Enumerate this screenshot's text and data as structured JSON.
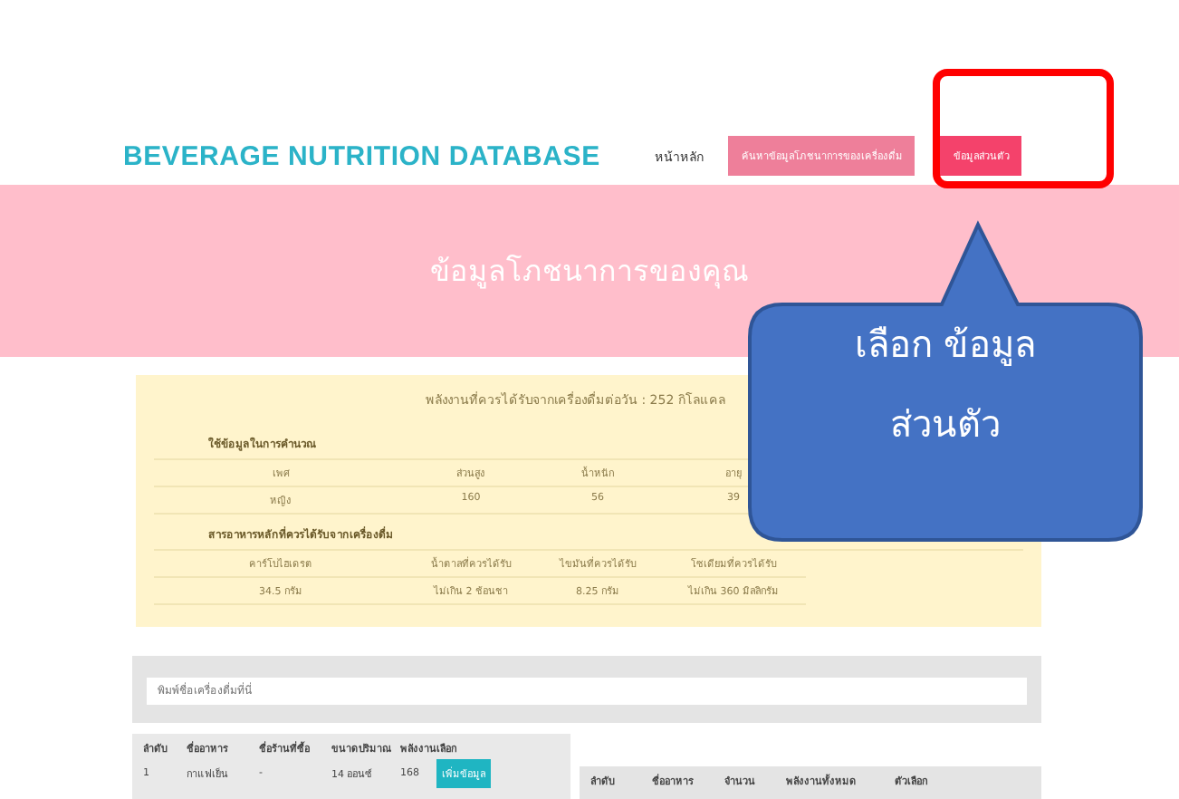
{
  "header": {
    "logo": "BEVERAGE NUTRITION DATABASE",
    "nav": [
      {
        "label": "หน้าหลัก",
        "kind": "link",
        "selected": false
      },
      {
        "label": "ค้นหาข้อมูลโภชนาการของเครื่องดื่ม",
        "kind": "button",
        "selected": false
      },
      {
        "label": "ข้อมูลส่วนตัว",
        "kind": "button",
        "selected": true
      }
    ]
  },
  "banner": {
    "title": "ข้อมูลโภชนาการของคุณ"
  },
  "summary": {
    "energy": "พลังงานที่ควรได้รับจากเครื่องดื่มต่อวัน : 252 กิโลแคล",
    "sections": [
      {
        "title": "ใช้ข้อมูลในการคำนวณ",
        "columns": [
          "เพศ",
          "ส่วนสูง",
          "น้ำหนัก",
          "อายุ"
        ],
        "values": [
          "หญิง",
          "160",
          "56",
          "39"
        ]
      },
      {
        "title": "สารอาหารหลักที่ควรได้รับจากเครื่องดื่ม",
        "columns": [
          "คาร์โบไฮเดรต",
          "น้ำตาลที่ควรได้รับ",
          "ไขมันที่ควรได้รับ",
          "โซเดียมที่ควรได้รับ"
        ],
        "values": [
          "34.5 กรัม",
          "ไม่เกิน 2 ช้อนชา",
          "8.25 กรัม",
          "ไม่เกิน 360 มิลลิกรัม"
        ]
      }
    ]
  },
  "search": {
    "placeholder": "พิมพ์ชื่อเครื่องดื่มที่นี่"
  },
  "drink_table": {
    "columns": [
      "ลำดับ",
      "ชื่ออาหาร",
      "ชื่อร้านที่ซื้อ",
      "ขนาดปริมาณ",
      "พลังงาน",
      "เลือก"
    ],
    "rows": [
      {
        "cells": [
          "1",
          "กาแฟเย็น",
          "-",
          "14 ออนซ์",
          "168"
        ],
        "action": "เพิ่มข้อมูล"
      }
    ]
  },
  "selected_table": {
    "columns": [
      "ลำดับ",
      "ชื่ออาหาร",
      "จำนวน",
      "พลังงานทั้งหมด",
      "ตัวเลือก"
    ]
  },
  "callout": {
    "text": "เลือก ข้อมูล ส่วนตัว"
  }
}
